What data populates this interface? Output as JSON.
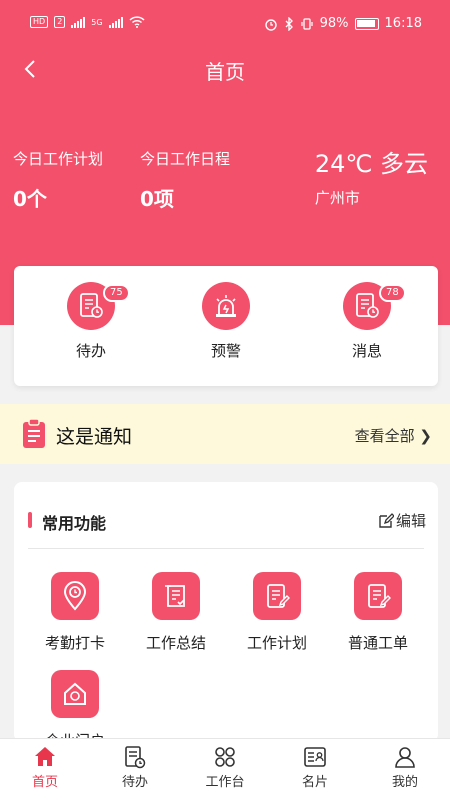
{
  "status_bar": {
    "hd": "HD",
    "sim": "2",
    "net": "5G",
    "battery": "98%",
    "time": "16:18"
  },
  "header": {
    "title": "首页"
  },
  "stats": [
    {
      "label": "今日工作计划",
      "value": "0个"
    },
    {
      "label": "今日工作日程",
      "value": "0项"
    }
  ],
  "weather": {
    "temp": "24℃ 多云",
    "city": "广州市"
  },
  "quick": [
    {
      "label": "待办",
      "badge": "75",
      "icon": "todo-doc-icon"
    },
    {
      "label": "预警",
      "badge": "",
      "icon": "alarm-icon"
    },
    {
      "label": "消息",
      "badge": "78",
      "icon": "message-doc-icon"
    }
  ],
  "notice": {
    "text": "这是通知",
    "more": "查看全部"
  },
  "functions": {
    "title": "常用功能",
    "edit": "编辑",
    "items": [
      {
        "label": "考勤打卡",
        "icon": "location-clock-icon"
      },
      {
        "label": "工作总结",
        "icon": "scroll-check-icon"
      },
      {
        "label": "工作计划",
        "icon": "doc-pencil-icon"
      },
      {
        "label": "普通工单",
        "icon": "doc-edit-icon"
      },
      {
        "label": "企业门户",
        "icon": "home-icon"
      }
    ]
  },
  "tabs": [
    {
      "label": "首页",
      "icon": "home-icon"
    },
    {
      "label": "待办",
      "icon": "todo-doc-icon"
    },
    {
      "label": "工作台",
      "icon": "grid-icon"
    },
    {
      "label": "名片",
      "icon": "card-icon"
    },
    {
      "label": "我的",
      "icon": "user-icon"
    }
  ],
  "colors": {
    "accent": "#f2506b",
    "notice_bg": "#fdf9da",
    "tab_active": "#e8374c"
  }
}
